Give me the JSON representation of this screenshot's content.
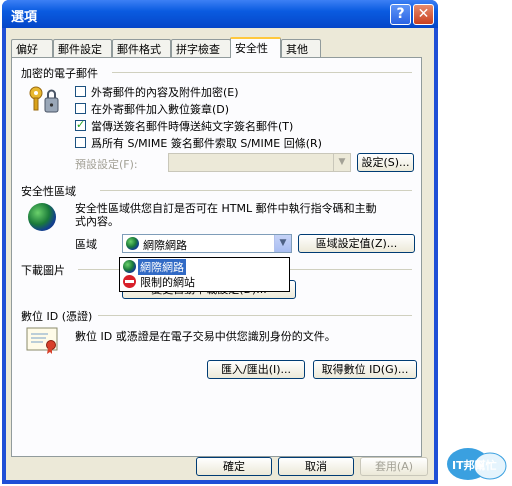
{
  "window": {
    "title": "選項",
    "help_label": "?",
    "close_label": "✕"
  },
  "tabs": [
    "偏好",
    "郵件設定",
    "郵件格式",
    "拼字檢查",
    "安全性",
    "其他"
  ],
  "encrypted_mail": {
    "header": "加密的電子郵件",
    "options": [
      {
        "label": "外寄郵件的內容及附件加密(E)",
        "checked": false
      },
      {
        "label": "在外寄郵件加入數位簽章(D)",
        "checked": false
      },
      {
        "label": "當傳送簽名郵件時傳送純文字簽名郵件(T)",
        "checked": true
      },
      {
        "label": "爲所有 S/MIME 簽名郵件索取 S/MIME 回條(R)",
        "checked": false
      }
    ],
    "default_setting_label": "預設設定(F):",
    "default_setting_value": "",
    "settings_button": "設定(S)..."
  },
  "security_zone": {
    "header": "安全性區域",
    "description_line1": "安全性區域供您自訂是否可在 HTML 郵件中執行指令碼和主動",
    "description_line2": "式內容。",
    "zone_label": "區域",
    "zone_value": "網際網路",
    "zone_settings_button": "區域設定值(Z)...",
    "dropdown_options": [
      "網際網路",
      "限制的網站"
    ]
  },
  "download_pictures": {
    "header": "下載圖片",
    "button_label": "變更自動下載設定(D)..."
  },
  "digital_id": {
    "header": "數位 ID (憑證)",
    "description": "數位 ID 或憑證是在電子交易中供您識別身份的文件。",
    "import_export_button": "匯入/匯出(I)...",
    "get_id_button": "取得數位 ID(G)..."
  },
  "footer": {
    "ok": "確定",
    "cancel": "取消",
    "apply": "套用(A)"
  },
  "watermark": {
    "text": "IT邦幫忙"
  }
}
